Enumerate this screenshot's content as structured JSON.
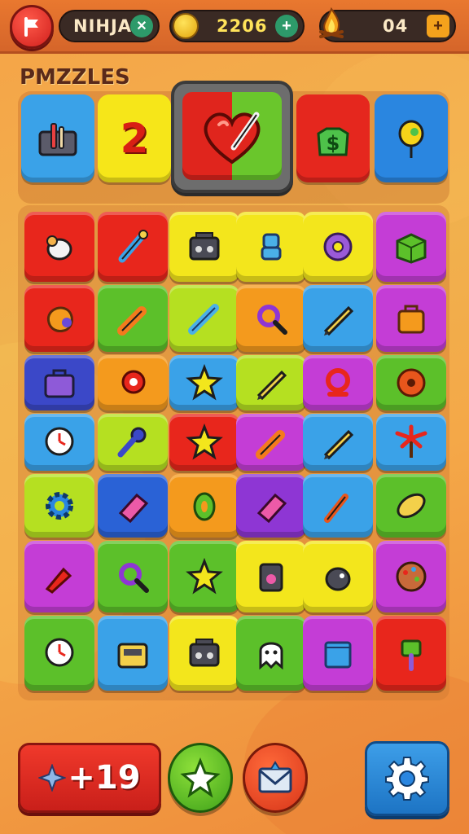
{
  "hud": {
    "player_name": "NIHJAN",
    "coins": "2206",
    "streak": "04"
  },
  "title": "PMZZLES",
  "selector": {
    "tiles": [
      {
        "color": "#3aa2e8",
        "icon": "kit-icon"
      },
      {
        "color": "#f6e619",
        "text": "2",
        "icon": "number-icon"
      },
      {
        "color": "split",
        "icon": "heart-brush-icon"
      },
      {
        "color": "#e5271e",
        "icon": "money-bag-icon"
      },
      {
        "color": "#2a86e0",
        "icon": "balloon-icon"
      }
    ]
  },
  "grid": {
    "rows": [
      [
        {
          "color": "#e8261c",
          "icon": "pacifier-icon"
        },
        {
          "color": "#e8261c",
          "icon": "brush-icon"
        },
        {
          "color": "#f3e61c",
          "icon": "radio-icon"
        },
        {
          "color": "#f3e61c",
          "icon": "robot-icon"
        },
        {
          "color": "#f3e61c",
          "icon": "donut-icon"
        },
        {
          "color": "#c43dd6",
          "icon": "box-icon"
        }
      ],
      [
        {
          "color": "#e8261c",
          "icon": "blob-icon"
        },
        {
          "color": "#5cc02a",
          "icon": "crayon-icon"
        },
        {
          "color": "#b5e021",
          "icon": "syringe-icon"
        },
        {
          "color": "#f49a1d",
          "icon": "magnifier-icon"
        },
        {
          "color": "#3aa2e8",
          "icon": "pencil-icon"
        },
        {
          "color": "#c43dd6",
          "icon": "bag-icon"
        }
      ],
      [
        {
          "color": "#3b48c8",
          "icon": "briefcase-icon"
        },
        {
          "color": "#f49a1d",
          "icon": "snail-icon"
        },
        {
          "color": "#3aa2e8",
          "icon": "star-icon"
        },
        {
          "color": "#b5e021",
          "icon": "pencil-icon"
        },
        {
          "color": "#c43dd6",
          "icon": "ring-icon"
        },
        {
          "color": "#5cc02a",
          "icon": "flower-icon"
        }
      ],
      [
        {
          "color": "#3aa2e8",
          "icon": "clock-icon"
        },
        {
          "color": "#b5e021",
          "icon": "key-icon"
        },
        {
          "color": "#e8261c",
          "icon": "star-icon"
        },
        {
          "color": "#c43dd6",
          "icon": "crayon-icon"
        },
        {
          "color": "#3aa2e8",
          "icon": "pencil-icon"
        },
        {
          "color": "#3aa2e8",
          "icon": "palm-icon"
        }
      ],
      [
        {
          "color": "#b5e021",
          "icon": "gear-icon"
        },
        {
          "color": "#2a62d6",
          "icon": "eraser-icon"
        },
        {
          "color": "#f49a1d",
          "icon": "seed-icon"
        },
        {
          "color": "#8e36d4",
          "icon": "eraser-icon"
        },
        {
          "color": "#3aa2e8",
          "icon": "pen-icon"
        },
        {
          "color": "#5cc02a",
          "icon": "football-icon"
        }
      ],
      [
        {
          "color": "#c43dd6",
          "icon": "rocket-icon"
        },
        {
          "color": "#5cc02a",
          "icon": "magnifier-icon"
        },
        {
          "color": "#5cc02a",
          "icon": "star-icon"
        },
        {
          "color": "#f3e61c",
          "icon": "speaker-icon"
        },
        {
          "color": "#f3e61c",
          "icon": "bird-icon"
        },
        {
          "color": "#c43dd6",
          "icon": "palette-icon"
        }
      ],
      [
        {
          "color": "#5cc02a",
          "icon": "clock-icon"
        },
        {
          "color": "#3aa2e8",
          "icon": "register-icon"
        },
        {
          "color": "#f3e61c",
          "icon": "radio-icon"
        },
        {
          "color": "#5cc02a",
          "icon": "ghost-icon"
        },
        {
          "color": "#c43dd6",
          "icon": "book-icon"
        },
        {
          "color": "#e8261c",
          "icon": "roller-icon"
        }
      ]
    ]
  },
  "footer": {
    "score": "+19"
  }
}
